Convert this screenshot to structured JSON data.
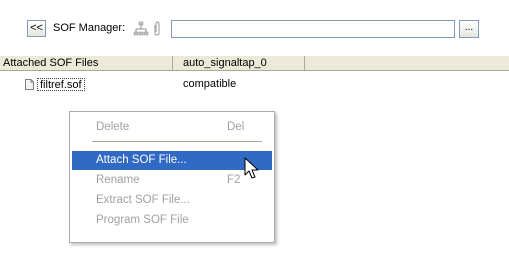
{
  "toolbar": {
    "collapse_label": "<<",
    "sof_manager_label": "SOF Manager:",
    "path_value": "",
    "browse_label": "..."
  },
  "table": {
    "columns": [
      "Attached SOF Files",
      "auto_signaltap_0"
    ],
    "rows": [
      {
        "file": "filtref.sof",
        "status": "compatible"
      }
    ]
  },
  "context_menu": {
    "items": [
      {
        "label": "Delete",
        "shortcut": "Del",
        "enabled": false
      },
      {
        "label": "Attach SOF File...",
        "shortcut": "",
        "enabled": true,
        "highlighted": true
      },
      {
        "label": "Rename",
        "shortcut": "F2",
        "enabled": false
      },
      {
        "label": "Extract SOF File...",
        "shortcut": "",
        "enabled": false
      },
      {
        "label": "Program SOF File",
        "shortcut": "",
        "enabled": false
      }
    ]
  },
  "icons": {
    "jtag": "jtag-chain-icon",
    "attach": "paperclip-icon",
    "file": "document-icon",
    "cursor": "mouse-pointer-icon"
  },
  "colors": {
    "highlight": "#316ac5",
    "disabled_text": "#a0a0a0",
    "header_bg": "#ece9d8"
  }
}
